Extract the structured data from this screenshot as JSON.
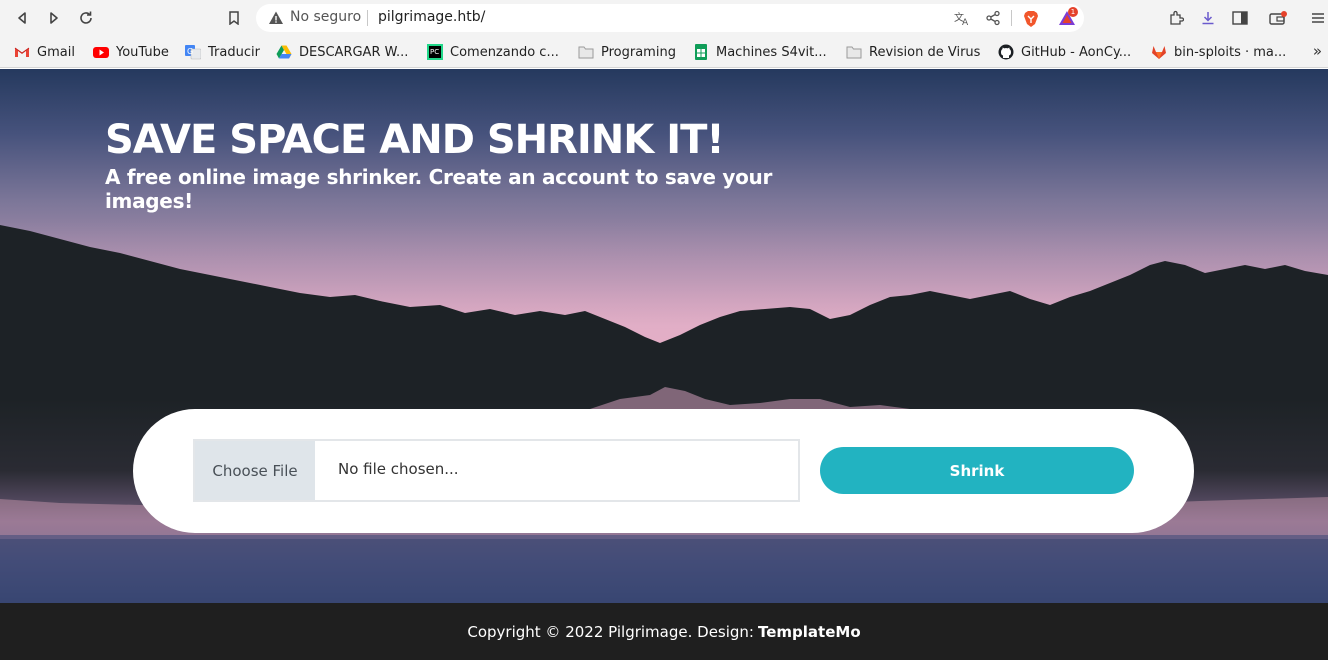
{
  "browser": {
    "url_security": "No seguro",
    "url": "pilgrimage.htb/",
    "shields_badge": "1",
    "bookmarks": [
      {
        "label": "Gmail",
        "icon": "gmail-icon"
      },
      {
        "label": "YouTube",
        "icon": "youtube-icon"
      },
      {
        "label": "Traducir",
        "icon": "translate-icon"
      },
      {
        "label": "DESCARGAR W...",
        "icon": "google-drive-icon"
      },
      {
        "label": "Comenzando c...",
        "icon": "pycharm-icon"
      },
      {
        "label": "Programing",
        "icon": "folder-icon"
      },
      {
        "label": "Machines S4vit...",
        "icon": "sheets-icon"
      },
      {
        "label": "Revision de Virus",
        "icon": "folder-icon"
      },
      {
        "label": "GitHub - AonCy...",
        "icon": "github-icon"
      },
      {
        "label": "bin-sploits · ma...",
        "icon": "gitlab-icon"
      }
    ],
    "more_label": "»"
  },
  "hero": {
    "title": "SAVE SPACE AND SHRINK IT!",
    "subtitle": "A free online image shrinker. Create an account to save your images!"
  },
  "upload": {
    "choose_label": "Choose File",
    "file_status": "No file chosen...",
    "submit_label": "Shrink"
  },
  "footer": {
    "text": "Copyright © 2022 Pilgrimage. Design:",
    "link": "TemplateMo"
  },
  "colors": {
    "accent": "#22b3c1",
    "footer_bg": "#1f1f1f"
  }
}
